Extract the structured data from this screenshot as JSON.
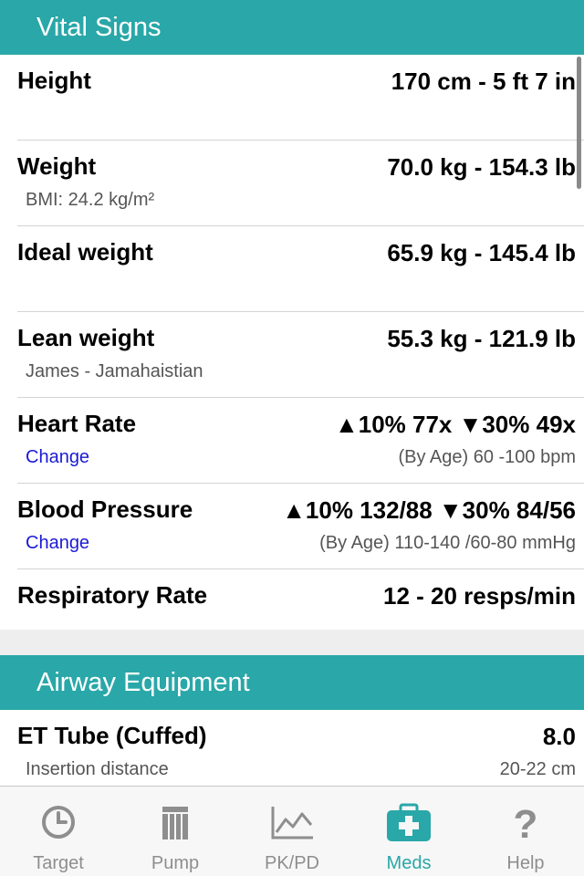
{
  "vitals": {
    "header": "Vital Signs",
    "rows": [
      {
        "label": "Height",
        "value": "170 cm - 5 ft 7 in"
      },
      {
        "label": "Weight",
        "value": "70.0 kg - 154.3 lb",
        "sub": "BMI: 24.2 kg/m²"
      },
      {
        "label": "Ideal weight",
        "value": "65.9 kg - 145.4 lb"
      },
      {
        "label": "Lean weight",
        "value": "55.3 kg - 121.9 lb",
        "sub": "James - Jamahaistian"
      },
      {
        "label": "Heart Rate",
        "value": "▲10% 77x ▼30% 49x",
        "sub": "Change",
        "subright": "(By Age) 60 -100 bpm"
      },
      {
        "label": "Blood Pressure",
        "value": "▲10% 132/88 ▼30% 84/56",
        "sub": "Change",
        "subright": "(By Age) 110-140 /60-80 mmHg"
      },
      {
        "label": "Respiratory Rate",
        "value": "12 - 20 resps/min"
      }
    ]
  },
  "airway": {
    "header": "Airway Equipment",
    "rows": [
      {
        "label": "ET Tube (Cuffed)",
        "value": "8.0",
        "sub": "Insertion distance",
        "subright": "20-22 cm"
      }
    ]
  },
  "tabbar": {
    "active": "meds",
    "accent_color": "#2aa7a8",
    "inactive_color": "#8e8e8e",
    "tabs": [
      {
        "label": "Target",
        "icon": "clock-icon"
      },
      {
        "label": "Pump",
        "icon": "pump-icon"
      },
      {
        "label": "PK/PD",
        "icon": "line-chart-icon"
      },
      {
        "label": "Meds",
        "icon": "medical-kit-icon"
      },
      {
        "label": "Help",
        "icon": "question-icon"
      }
    ]
  },
  "colors": {
    "header_bg": "#2aa7a8",
    "link": "#1a1ad6"
  }
}
